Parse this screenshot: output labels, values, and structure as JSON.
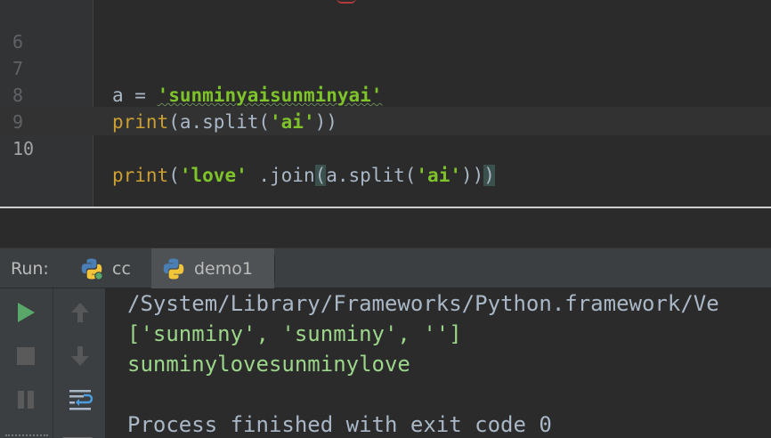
{
  "editor": {
    "lines": [
      {
        "number": "6",
        "code": ""
      },
      {
        "number": "7",
        "var": "a",
        "op": " = ",
        "str": "'sunminyaisunminyai'"
      },
      {
        "number": "8",
        "fn": "print",
        "rest": "(a.split(",
        "str": "'ai'",
        "close": "))"
      },
      {
        "number": "9",
        "code": ""
      },
      {
        "number": "10",
        "fn": "print",
        "open": "(",
        "str1": "'love'",
        "mid": " .join",
        "p1": "(",
        "mid2": "a.split(",
        "str2": "'ai'",
        "close1": ")",
        "close2": ")",
        "p2": ")"
      }
    ],
    "current_line": "10"
  },
  "run": {
    "title": "Run:",
    "tabs": [
      {
        "label": "cc",
        "active": false
      },
      {
        "label": "demo1",
        "active": true
      }
    ],
    "console": {
      "path": "/System/Library/Frameworks/Python.framework/Ve",
      "output1": "['sunminy', 'sunminy', '']",
      "output2": "sunminylovesunminylove",
      "blank": "",
      "process": "Process finished with exit code 0"
    },
    "toolbar": [
      "play-icon",
      "stop-icon",
      "pause-icon",
      "up-arrow-icon",
      "down-arrow-icon",
      "soft-wrap-icon",
      "print-icon"
    ]
  },
  "colors": {
    "background": "#2b2b2b",
    "builtin": "#cc9f33",
    "string": "#7ec32a",
    "text": "#a9b7c6",
    "run_green": "#59a869"
  }
}
